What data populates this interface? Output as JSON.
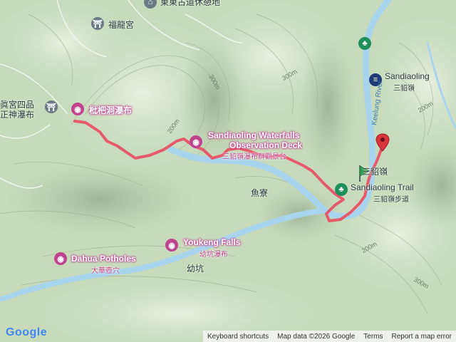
{
  "map": {
    "labels": {
      "top_rest_area": "東東古道休憩地",
      "fulong_temple": "福龍宮",
      "left_temple_line1": "眞宮四品",
      "left_temple_line2": "正神瀑布",
      "loquat_falls": "枇杷洞瀑布",
      "deck_line1": "Sandiaoling Waterfalls",
      "deck_line2": "Observation Deck",
      "deck_sub": "三貂嶺瀑布群觀景台",
      "station_en": "Sandiaoling",
      "station_zh": "三貂嶺",
      "river": "Keelung River",
      "sandiao_zh": "三貂嶺",
      "trail_en": "Sandiaoling Trail",
      "trail_zh": "三貂嶺步道",
      "yuliao": "魚寮",
      "youkeng_en": "Youkeng Falls",
      "youkeng_zh": "幼坑瀑布",
      "youkeng_village": "幼坑",
      "dahua_en": "Dahua Potholes",
      "dahua_zh": "大華壺穴"
    },
    "elevations": [
      "300m",
      "200m",
      "200m",
      "300m",
      "200m",
      "300m"
    ],
    "icons": {
      "temple": "temple-icon",
      "camera": "camera-icon",
      "park": "park-icon",
      "train": "train-icon",
      "start": "green-flag-icon",
      "end": "red-pin-icon"
    },
    "colors": {
      "route": "#e65a6a",
      "river": "#a9d4ee",
      "poi_pink": "#c0438e",
      "start_green": "#2e9d4f",
      "end_red": "#d9343c"
    }
  },
  "attribution": {
    "logo": "Google",
    "shortcuts": "Keyboard shortcuts",
    "map_data": "Map data ©2026 Google",
    "terms": "Terms",
    "report": "Report a map error"
  }
}
